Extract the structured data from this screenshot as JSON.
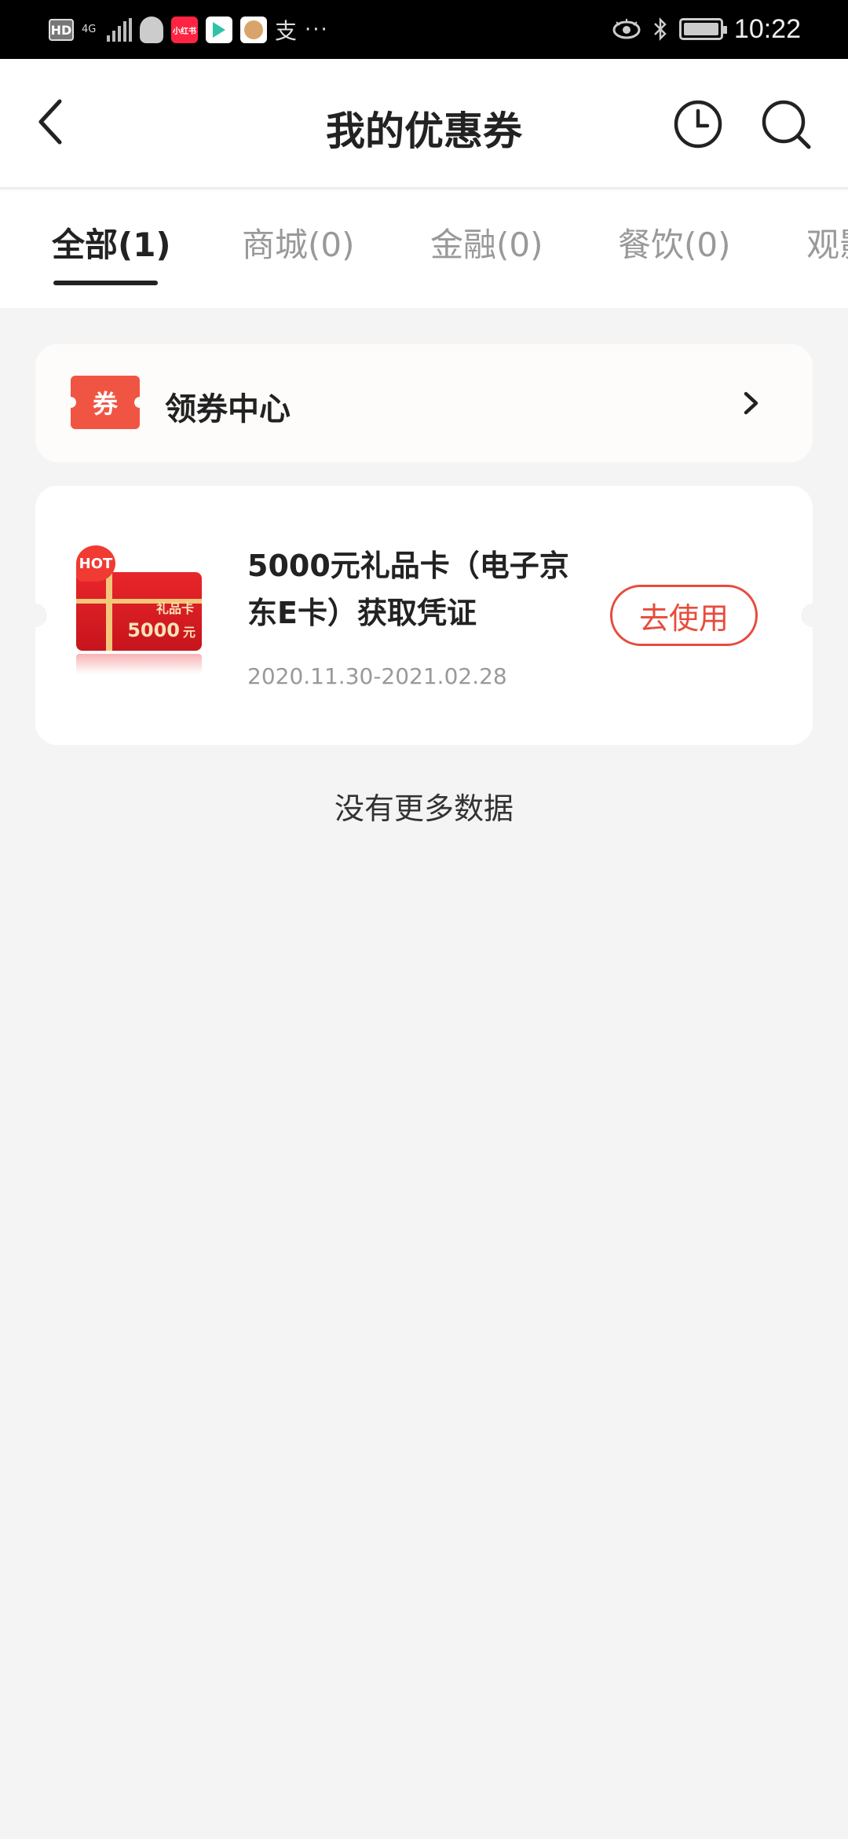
{
  "status_bar": {
    "hd": "HD",
    "network": "4G",
    "app_icon_label": "小红书",
    "alipay_glyph": "支",
    "more": "···",
    "time": "10:22"
  },
  "header": {
    "title": "我的优惠券"
  },
  "tabs": [
    {
      "label": "全部(1)",
      "active": true
    },
    {
      "label": "商城(0)",
      "active": false
    },
    {
      "label": "金融(0)",
      "active": false
    },
    {
      "label": "餐饮(0)",
      "active": false
    },
    {
      "label": "观影",
      "active": false
    }
  ],
  "coupon_center": {
    "badge": "券",
    "label": "领券中心"
  },
  "coupon": {
    "hot": "HOT",
    "gift_card_name": "礼品卡",
    "gift_card_amount": "5000",
    "gift_card_unit": "元",
    "title": "5000元礼品卡（电子京东E卡）获取凭证",
    "date_range": "2020.11.30-2021.02.28",
    "use_label": "去使用"
  },
  "footer_text": "没有更多数据",
  "colors": {
    "accent_red": "#e74c3c",
    "badge_red": "#f05544",
    "page_bg": "#f4f4f4"
  }
}
